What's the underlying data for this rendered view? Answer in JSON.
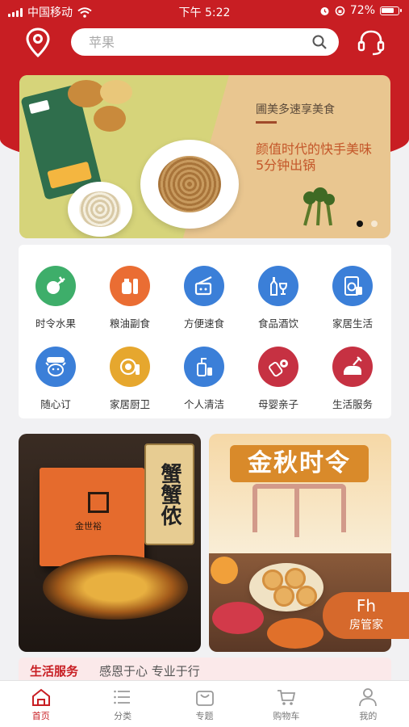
{
  "status_bar": {
    "carrier": "中国移动",
    "time": "下午 5:22",
    "battery": "72%"
  },
  "search": {
    "placeholder": "苹果"
  },
  "banner": {
    "title": "圃美多速享美食",
    "line1": "颜值时代的快手美味",
    "line2": "5分钟出锅",
    "slide_count": 2,
    "active_slide": 1
  },
  "categories": [
    {
      "label": "时令水果",
      "color": "#3eae6a",
      "icon": "fruit-icon"
    },
    {
      "label": "粮油副食",
      "color": "#ea6d33",
      "icon": "grain-oil-icon"
    },
    {
      "label": "方便速食",
      "color": "#3b7fd8",
      "icon": "instant-food-icon"
    },
    {
      "label": "食品酒饮",
      "color": "#3b7fd8",
      "icon": "wine-icon"
    },
    {
      "label": "家居生活",
      "color": "#3b7fd8",
      "icon": "home-appliance-icon"
    },
    {
      "label": "随心订",
      "color": "#3b7fd8",
      "icon": "subscribe-icon"
    },
    {
      "label": "家居厨卫",
      "color": "#e6a72e",
      "icon": "kitchen-icon"
    },
    {
      "label": "个人清洁",
      "color": "#3b7fd8",
      "icon": "personal-care-icon"
    },
    {
      "label": "母婴亲子",
      "color": "#c63142",
      "icon": "baby-bottle-icon"
    },
    {
      "label": "生活服务",
      "color": "#c63142",
      "icon": "life-service-icon"
    }
  ],
  "promos": {
    "left": {
      "vertical_text": "蟹蟹侬",
      "brand": "金世裕"
    },
    "right": {
      "title": "金秋时令"
    }
  },
  "floating_button": {
    "icon_text": "Fh",
    "label": "房管家"
  },
  "life_service": {
    "title": "生活服务",
    "subtitle": "感恩于心 专业于行"
  },
  "tabbar": [
    {
      "label": "首页",
      "icon": "home-icon",
      "active": true
    },
    {
      "label": "分类",
      "icon": "category-icon",
      "active": false
    },
    {
      "label": "专题",
      "icon": "topic-bag-icon",
      "active": false
    },
    {
      "label": "购物车",
      "icon": "cart-icon",
      "active": false
    },
    {
      "label": "我的",
      "icon": "profile-icon",
      "active": false
    }
  ],
  "colors": {
    "brand_red": "#c81e23",
    "accent_orange": "#d6692c"
  }
}
